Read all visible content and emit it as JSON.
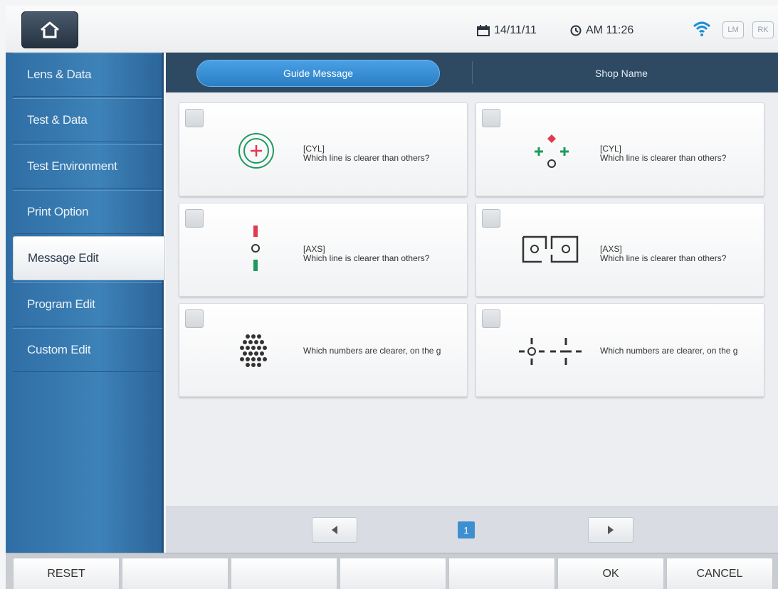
{
  "status": {
    "date": "14/11/11",
    "time": "AM 11:26",
    "badge_lm": "LM",
    "badge_rk": "RK"
  },
  "sidebar": {
    "items": [
      {
        "label": "Lens & Data"
      },
      {
        "label": "Test & Data"
      },
      {
        "label": "Test Environment"
      },
      {
        "label": "Print Option"
      },
      {
        "label": "Message Edit"
      },
      {
        "label": "Program Edit"
      },
      {
        "label": "Custom Edit"
      }
    ],
    "active": "Message Edit"
  },
  "tabs": [
    {
      "label": "Guide Message",
      "active": true
    },
    {
      "label": "Shop Name",
      "active": false
    }
  ],
  "cards": [
    {
      "tag": "[CYL]",
      "text": "Which line is clearer than others?",
      "icon": "cyl-concentric-circle-icon",
      "checked": false
    },
    {
      "tag": "[CYL]",
      "text": "Which line is clearer than others?",
      "icon": "cyl-cross-points-icon",
      "checked": false
    },
    {
      "tag": "[AXS]",
      "text": "Which line is clearer than others?",
      "icon": "axs-vertical-bars-icon",
      "checked": false
    },
    {
      "tag": "[AXS]",
      "text": "Which line is clearer than others?",
      "icon": "axs-bracket-circles-icon",
      "checked": false
    },
    {
      "tag": "",
      "text": "Which numbers are clearer, on the g",
      "icon": "dot-cluster-icon",
      "checked": false
    },
    {
      "tag": "",
      "text": "Which numbers are clearer, on the g",
      "icon": "dashed-line-circle-icon",
      "checked": false
    }
  ],
  "pager": {
    "current_page": "1"
  },
  "bottom": {
    "buttons": [
      "RESET",
      "",
      "",
      "",
      "",
      "OK",
      "CANCEL"
    ]
  },
  "colors": {
    "accent": "#2a7fc4",
    "sidebar": "#3d82b8",
    "red": "#e03a4e",
    "green": "#1e9a5e"
  }
}
